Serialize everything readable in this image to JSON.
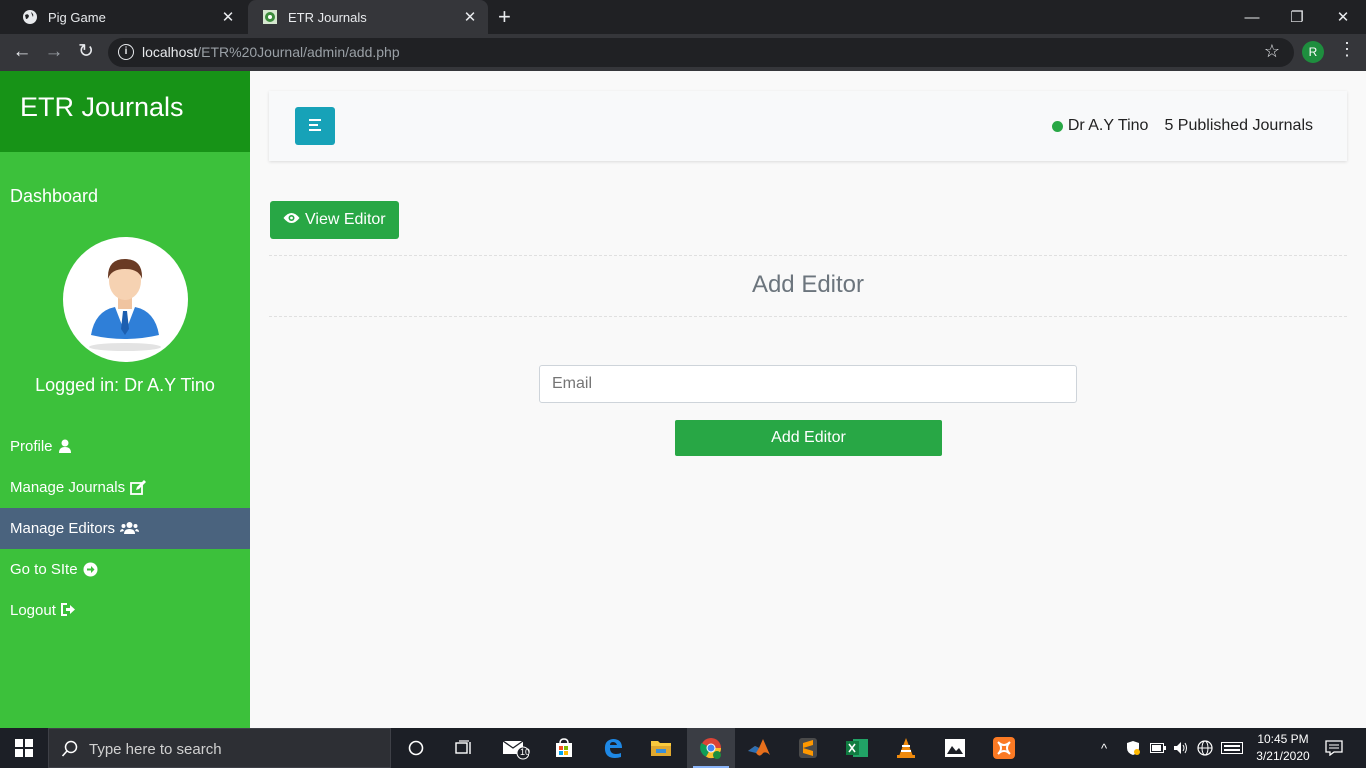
{
  "browser": {
    "tabs": [
      {
        "title": "Pig Game",
        "icon": "globe-icon"
      },
      {
        "title": "ETR Journals",
        "icon": "site-favicon"
      }
    ],
    "url_host": "localhost",
    "url_path": "/ETR%20Journal/admin/add.php",
    "profile_initial": "R"
  },
  "sidebar": {
    "brand": "ETR Journals",
    "dashboard": "Dashboard",
    "logged_in": "Logged in: Dr A.Y Tino",
    "items": [
      {
        "label": "Profile",
        "icon": "user-icon"
      },
      {
        "label": "Manage Journals",
        "icon": "edit-icon"
      },
      {
        "label": "Manage Editors",
        "icon": "users-icon",
        "active": true
      },
      {
        "label": "Go to SIte",
        "icon": "arrow-circle-right-icon"
      },
      {
        "label": "Logout",
        "icon": "sign-out-icon"
      }
    ]
  },
  "header": {
    "user_name": "Dr A.Y Tino",
    "published": "5 Published Journals",
    "status_color": "#28a745"
  },
  "main": {
    "view_button": "View Editor",
    "heading": "Add Editor",
    "email_placeholder": "Email",
    "submit_label": "Add Editor"
  },
  "taskbar": {
    "search_placeholder": "Type here to search",
    "mail_badge": "10",
    "time": "10:45 PM",
    "date": "3/21/2020"
  },
  "colors": {
    "sidebar": "#3cc13b",
    "brand": "#179317",
    "active_item": "#4a637e",
    "success": "#28a745",
    "toggle": "#17a2b8"
  }
}
